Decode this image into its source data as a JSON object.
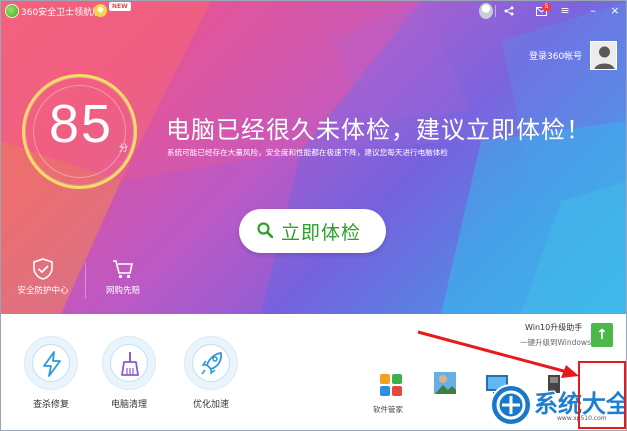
{
  "titlebar": {
    "app_title": "360安全卫士领航版",
    "new_badge": "NEW",
    "mail_count": "5"
  },
  "account": {
    "login_label": "登录360帐号"
  },
  "score": {
    "value": "85",
    "unit": "分"
  },
  "headline": "电脑已经很久未体检，建议立即体检！",
  "subline": "系统可能已经存在大量风险，安全度和性能都在极速下降，建议您每天进行电脑体检",
  "check_button_label": "立即体检",
  "quick_entries": [
    {
      "label": "安全防护中心",
      "icon": "shield-check-icon"
    },
    {
      "label": "网购先赔",
      "icon": "shopping-cart-icon"
    }
  ],
  "tools": [
    {
      "label": "查杀修复",
      "icon": "lightning-icon"
    },
    {
      "label": "电脑清理",
      "icon": "broom-icon"
    },
    {
      "label": "优化加速",
      "icon": "rocket-icon"
    }
  ],
  "win10_helper": {
    "title": "Win10升级助手",
    "subtitle": "一键升级到Windows 10"
  },
  "apps": {
    "software_manager_label": "软件管家"
  },
  "watermark": {
    "text": "系统大全",
    "domain": "www.xp510.com"
  },
  "colors": {
    "accent_green": "#2aa22a",
    "annotation_red": "#e61a1a",
    "score_ring": "#f3dd66"
  }
}
